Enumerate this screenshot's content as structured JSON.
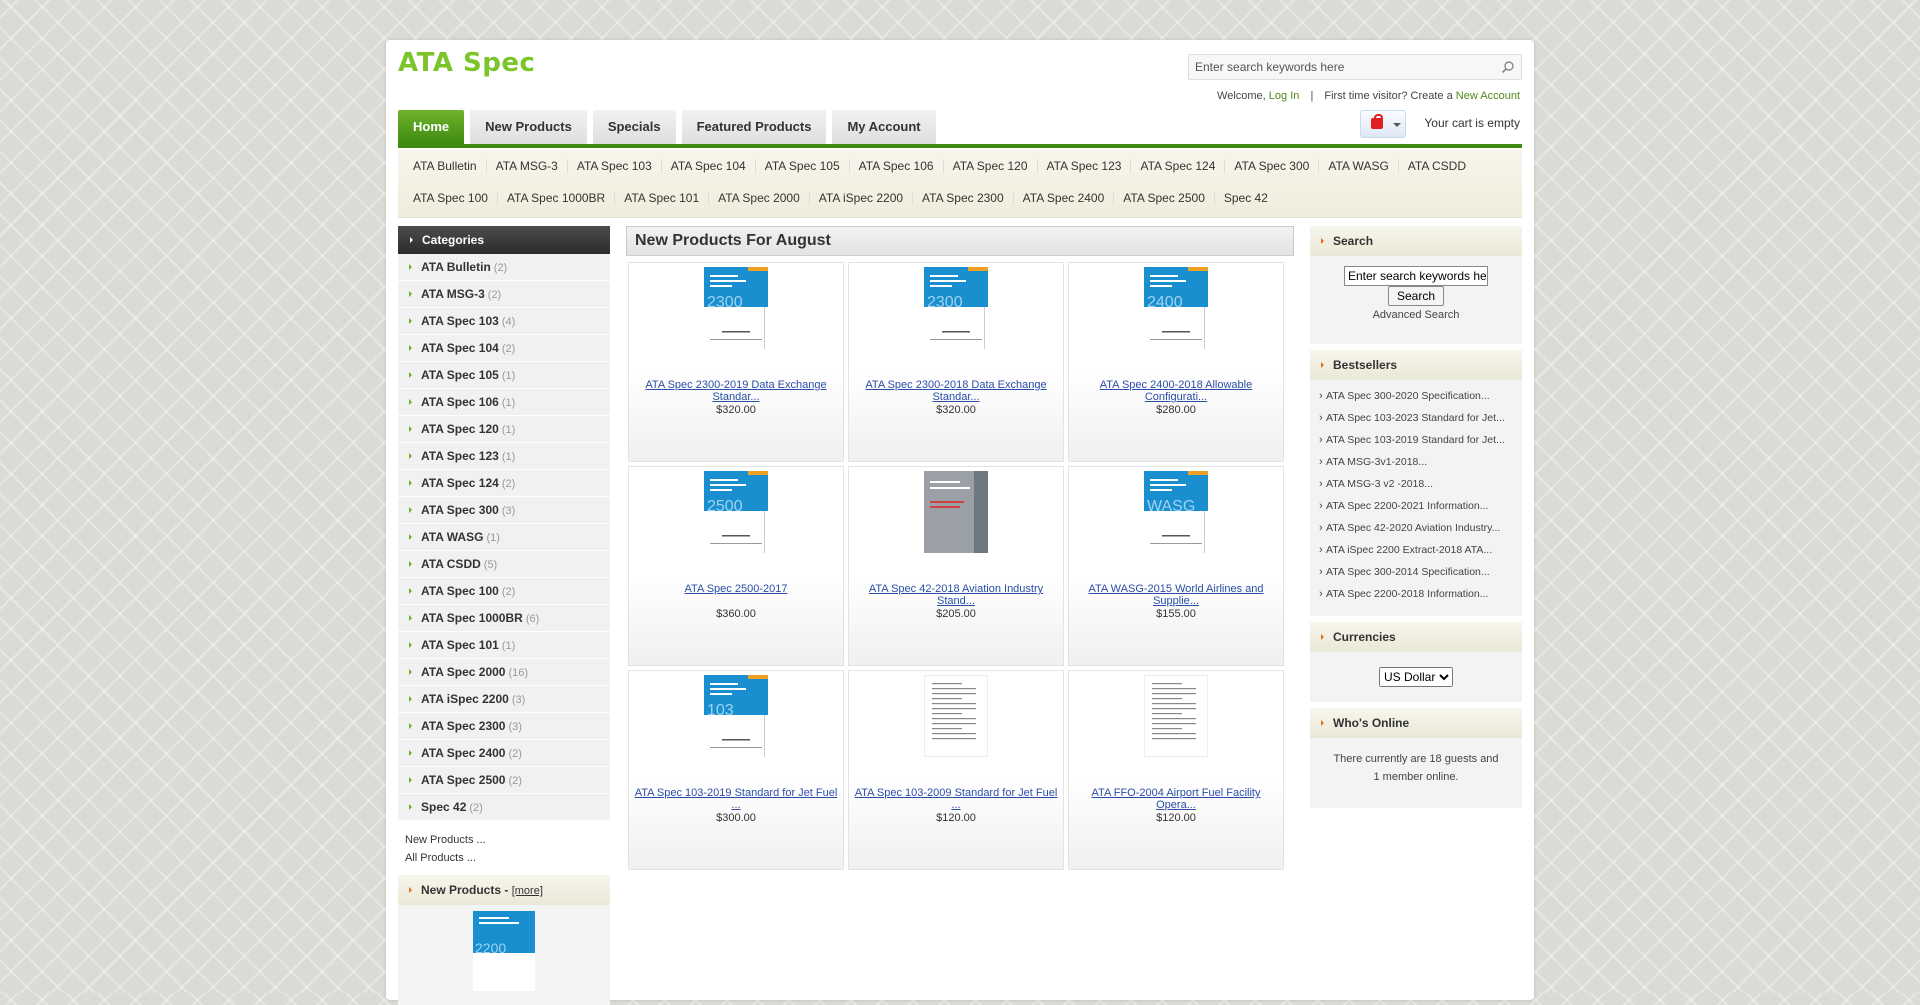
{
  "header": {
    "logo": "ATA Spec",
    "search_placeholder": "Enter search keywords here",
    "welcome_prefix": "Welcome,",
    "login": "Log In",
    "first_time": "First time visitor? Create a",
    "new_account": "New Account",
    "cart_text": "Your cart is empty"
  },
  "tabs": [
    {
      "label": "Home"
    },
    {
      "label": "New Products"
    },
    {
      "label": "Specials"
    },
    {
      "label": "Featured Products"
    },
    {
      "label": "My Account"
    }
  ],
  "catbar": {
    "row1": [
      "ATA Bulletin",
      "ATA MSG-3",
      "ATA Spec 103",
      "ATA Spec 104",
      "ATA Spec 105",
      "ATA Spec 106",
      "ATA Spec 120",
      "ATA Spec 123",
      "ATA Spec 124",
      "ATA Spec 300",
      "ATA WASG",
      "ATA CSDD"
    ],
    "row2": [
      "ATA Spec 100",
      "ATA Spec 1000BR",
      "ATA Spec 101",
      "ATA Spec 2000",
      "ATA iSpec 2200",
      "ATA Spec 2300",
      "ATA Spec 2400",
      "ATA Spec 2500",
      "Spec 42"
    ]
  },
  "categories": {
    "title": "Categories",
    "items": [
      {
        "name": "ATA Bulletin",
        "count": "(2)"
      },
      {
        "name": "ATA MSG-3",
        "count": "(2)"
      },
      {
        "name": "ATA Spec 103",
        "count": "(4)"
      },
      {
        "name": "ATA Spec 104",
        "count": "(2)"
      },
      {
        "name": "ATA Spec 105",
        "count": "(1)"
      },
      {
        "name": "ATA Spec 106",
        "count": "(1)"
      },
      {
        "name": "ATA Spec 120",
        "count": "(1)"
      },
      {
        "name": "ATA Spec 123",
        "count": "(1)"
      },
      {
        "name": "ATA Spec 124",
        "count": "(2)"
      },
      {
        "name": "ATA Spec 300",
        "count": "(3)"
      },
      {
        "name": "ATA WASG",
        "count": "(1)"
      },
      {
        "name": "ATA CSDD",
        "count": "(5)"
      },
      {
        "name": "ATA Spec 100",
        "count": "(2)"
      },
      {
        "name": "ATA Spec 1000BR",
        "count": "(6)"
      },
      {
        "name": "ATA Spec 101",
        "count": "(1)"
      },
      {
        "name": "ATA Spec 2000",
        "count": "(16)"
      },
      {
        "name": "ATA iSpec 2200",
        "count": "(3)"
      },
      {
        "name": "ATA Spec 2300",
        "count": "(3)"
      },
      {
        "name": "ATA Spec 2400",
        "count": "(2)"
      },
      {
        "name": "ATA Spec 2500",
        "count": "(2)"
      },
      {
        "name": "Spec 42",
        "count": "(2)"
      }
    ],
    "new_products_link": "New Products ...",
    "all_products_link": "All Products ..."
  },
  "new_products_box": {
    "title": "New Products -",
    "more": "[more]"
  },
  "center": {
    "title": "New Products For August",
    "products": [
      {
        "title": "ATA Spec 2300-2019 Data Exchange Standar...",
        "price": "$320.00",
        "cover": "blue",
        "cover_text": "2300"
      },
      {
        "title": "ATA Spec 2300-2018 Data Exchange Standar...",
        "price": "$320.00",
        "cover": "blue",
        "cover_text": "2300"
      },
      {
        "title": "ATA Spec 2400-2018 Allowable Configurati...",
        "price": "$280.00",
        "cover": "blue",
        "cover_text": "2400"
      },
      {
        "title": "ATA Spec 2500-2017",
        "price": "$360.00",
        "cover": "blue",
        "cover_text": "2500"
      },
      {
        "title": "ATA Spec 42-2018 Aviation Industry Stand...",
        "price": "$205.00",
        "cover": "gray",
        "cover_text": ""
      },
      {
        "title": "ATA WASG-2015 World Airlines and Supplie...",
        "price": "$155.00",
        "cover": "blue",
        "cover_text": "WASG"
      },
      {
        "title": "ATA Spec 103-2019 Standard for Jet Fuel ...",
        "price": "$300.00",
        "cover": "blue",
        "cover_text": "103"
      },
      {
        "title": "ATA Spec 103-2009 Standard for Jet Fuel ...",
        "price": "$120.00",
        "cover": "doc",
        "cover_text": ""
      },
      {
        "title": "ATA FFO-2004 Airport Fuel Facility Opera...",
        "price": "$120.00",
        "cover": "doc",
        "cover_text": ""
      }
    ]
  },
  "right": {
    "search_title": "Search",
    "search_placeholder": "Enter search keywords here",
    "search_button": "Search",
    "advanced": "Advanced Search",
    "bestsellers_title": "Bestsellers",
    "bestsellers": [
      "ATA Spec 300-2020 Specification...",
      "ATA Spec 103-2023 Standard for Jet...",
      "ATA Spec 103-2019 Standard for Jet...",
      "ATA MSG-3v1-2018...",
      "ATA MSG-3 v2 -2018...",
      "ATA Spec 2200-2021 Information...",
      "ATA Spec 42-2020 Aviation Industry...",
      "ATA iSpec 2200 Extract-2018 ATA...",
      "ATA Spec 300-2014 Specification...",
      "ATA Spec 2200-2018 Information..."
    ],
    "currencies_title": "Currencies",
    "currency_selected": "US Dollar",
    "whos_online_title": "Who's Online",
    "online_text": "There currently are 18 guests and 1 member online."
  },
  "colors": {
    "brand_green": "#6fb42b",
    "dark_green": "#3f8a12",
    "cover_blue": "#1a8fd0"
  }
}
